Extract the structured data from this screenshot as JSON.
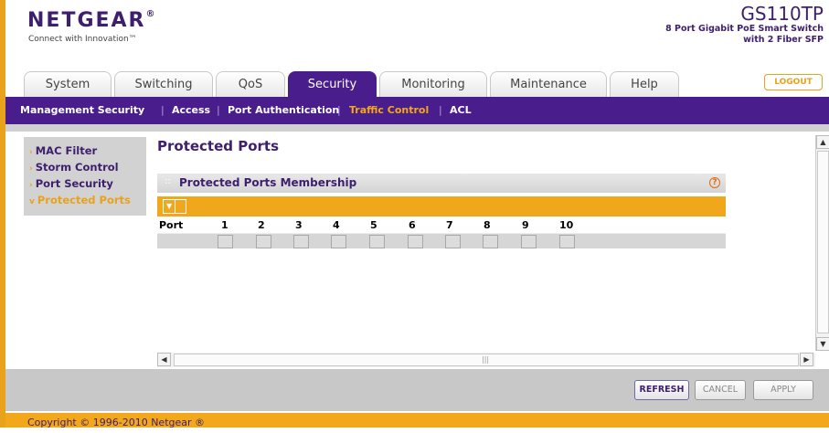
{
  "brand": {
    "logo": "NETGEAR",
    "logo_mark": "®",
    "tagline": "Connect with Innovation™"
  },
  "device": {
    "model": "GS110TP",
    "desc_line1": "8 Port Gigabit PoE Smart Switch",
    "desc_line2": "with 2 Fiber SFP"
  },
  "tabs": [
    "System",
    "Switching",
    "QoS",
    "Security",
    "Monitoring",
    "Maintenance",
    "Help"
  ],
  "active_tab": "Security",
  "logout_label": "LOGOUT",
  "subnav": [
    "Management Security",
    "Access",
    "Port Authentication",
    "Traffic Control",
    "ACL"
  ],
  "subnav_active": "Traffic Control",
  "sidebar": [
    {
      "label": "MAC Filter",
      "arrow": "›",
      "active": false
    },
    {
      "label": "Storm Control",
      "arrow": "›",
      "active": false
    },
    {
      "label": "Port Security",
      "arrow": "›",
      "active": false
    },
    {
      "label": "Protected Ports",
      "arrow": "v",
      "active": true
    }
  ],
  "page_title": "Protected Ports",
  "section": {
    "title": "Protected Ports Membership",
    "help": "?"
  },
  "ports": {
    "header": "Port",
    "numbers": [
      "1",
      "2",
      "3",
      "4",
      "5",
      "6",
      "7",
      "8",
      "9",
      "10"
    ]
  },
  "buttons": {
    "refresh": "REFRESH",
    "cancel": "CANCEL",
    "apply": "APPLY"
  },
  "copyright": "Copyright © 1996-2010 Netgear ®",
  "colors": {
    "purple": "#4a1d8c",
    "orange": "#f0a71c",
    "gray": "#d0d0d0"
  }
}
